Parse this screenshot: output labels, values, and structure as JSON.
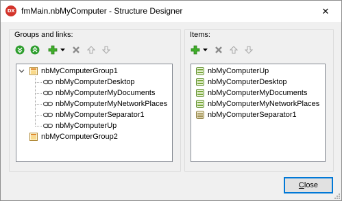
{
  "window": {
    "app_icon_text": "DX",
    "title": "fmMain.nbMyComputer - Structure Designer",
    "close_glyph": "✕"
  },
  "groups_panel": {
    "caption": "Groups and links:",
    "toolbar": {
      "icons": [
        "expand-all-icon",
        "collapse-all-icon",
        "add-icon",
        "dropdown-arrow-icon",
        "delete-icon",
        "move-up-icon",
        "move-down-icon"
      ]
    },
    "tree": [
      {
        "label": "nbMyComputerGroup1",
        "kind": "group",
        "expanded": true,
        "children": [
          {
            "label": "nbMyComputerDesktop",
            "kind": "link"
          },
          {
            "label": "nbMyComputerMyDocuments",
            "kind": "link"
          },
          {
            "label": "nbMyComputerMyNetworkPlaces",
            "kind": "link"
          },
          {
            "label": "nbMyComputerSeparator1",
            "kind": "link"
          },
          {
            "label": "nbMyComputerUp",
            "kind": "link"
          }
        ]
      },
      {
        "label": "nbMyComputerGroup2",
        "kind": "group",
        "expanded": false,
        "children": []
      }
    ]
  },
  "items_panel": {
    "caption": "Items:",
    "toolbar": {
      "icons": [
        "add-icon",
        "dropdown-arrow-icon",
        "delete-icon",
        "move-up-icon",
        "move-down-icon"
      ]
    },
    "items": [
      {
        "label": "nbMyComputerUp",
        "kind": "item"
      },
      {
        "label": "nbMyComputerDesktop",
        "kind": "item"
      },
      {
        "label": "nbMyComputerMyDocuments",
        "kind": "item"
      },
      {
        "label": "nbMyComputerMyNetworkPlaces",
        "kind": "item"
      },
      {
        "label": "nbMyComputerSeparator1",
        "kind": "separator"
      }
    ]
  },
  "footer": {
    "close_button_label": "Close",
    "close_button_mnemonic": "C",
    "close_button_rest": "lose"
  },
  "colors": {
    "app_icon": "#d3342b",
    "toolbar_green": "#2e9e2e",
    "focus_border": "#0078d7"
  }
}
